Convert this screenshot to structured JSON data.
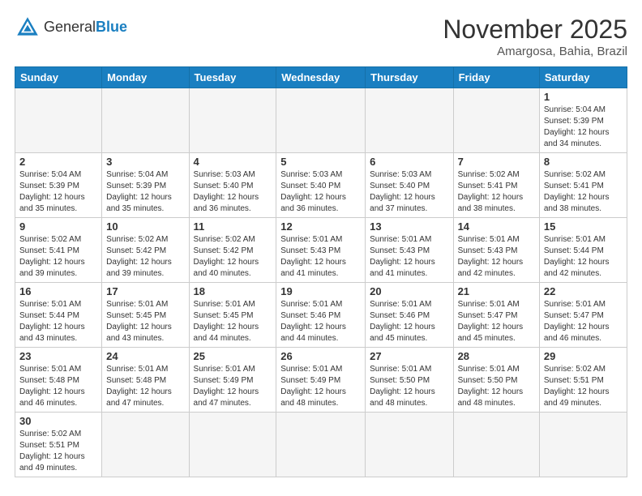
{
  "header": {
    "logo_general": "General",
    "logo_blue": "Blue",
    "month_year": "November 2025",
    "location": "Amargosa, Bahia, Brazil"
  },
  "days_of_week": [
    "Sunday",
    "Monday",
    "Tuesday",
    "Wednesday",
    "Thursday",
    "Friday",
    "Saturday"
  ],
  "weeks": [
    [
      {
        "day": "",
        "info": ""
      },
      {
        "day": "",
        "info": ""
      },
      {
        "day": "",
        "info": ""
      },
      {
        "day": "",
        "info": ""
      },
      {
        "day": "",
        "info": ""
      },
      {
        "day": "",
        "info": ""
      },
      {
        "day": "1",
        "info": "Sunrise: 5:04 AM\nSunset: 5:39 PM\nDaylight: 12 hours and 34 minutes."
      }
    ],
    [
      {
        "day": "2",
        "info": "Sunrise: 5:04 AM\nSunset: 5:39 PM\nDaylight: 12 hours and 35 minutes."
      },
      {
        "day": "3",
        "info": "Sunrise: 5:04 AM\nSunset: 5:39 PM\nDaylight: 12 hours and 35 minutes."
      },
      {
        "day": "4",
        "info": "Sunrise: 5:03 AM\nSunset: 5:40 PM\nDaylight: 12 hours and 36 minutes."
      },
      {
        "day": "5",
        "info": "Sunrise: 5:03 AM\nSunset: 5:40 PM\nDaylight: 12 hours and 36 minutes."
      },
      {
        "day": "6",
        "info": "Sunrise: 5:03 AM\nSunset: 5:40 PM\nDaylight: 12 hours and 37 minutes."
      },
      {
        "day": "7",
        "info": "Sunrise: 5:02 AM\nSunset: 5:41 PM\nDaylight: 12 hours and 38 minutes."
      },
      {
        "day": "8",
        "info": "Sunrise: 5:02 AM\nSunset: 5:41 PM\nDaylight: 12 hours and 38 minutes."
      }
    ],
    [
      {
        "day": "9",
        "info": "Sunrise: 5:02 AM\nSunset: 5:41 PM\nDaylight: 12 hours and 39 minutes."
      },
      {
        "day": "10",
        "info": "Sunrise: 5:02 AM\nSunset: 5:42 PM\nDaylight: 12 hours and 39 minutes."
      },
      {
        "day": "11",
        "info": "Sunrise: 5:02 AM\nSunset: 5:42 PM\nDaylight: 12 hours and 40 minutes."
      },
      {
        "day": "12",
        "info": "Sunrise: 5:01 AM\nSunset: 5:43 PM\nDaylight: 12 hours and 41 minutes."
      },
      {
        "day": "13",
        "info": "Sunrise: 5:01 AM\nSunset: 5:43 PM\nDaylight: 12 hours and 41 minutes."
      },
      {
        "day": "14",
        "info": "Sunrise: 5:01 AM\nSunset: 5:43 PM\nDaylight: 12 hours and 42 minutes."
      },
      {
        "day": "15",
        "info": "Sunrise: 5:01 AM\nSunset: 5:44 PM\nDaylight: 12 hours and 42 minutes."
      }
    ],
    [
      {
        "day": "16",
        "info": "Sunrise: 5:01 AM\nSunset: 5:44 PM\nDaylight: 12 hours and 43 minutes."
      },
      {
        "day": "17",
        "info": "Sunrise: 5:01 AM\nSunset: 5:45 PM\nDaylight: 12 hours and 43 minutes."
      },
      {
        "day": "18",
        "info": "Sunrise: 5:01 AM\nSunset: 5:45 PM\nDaylight: 12 hours and 44 minutes."
      },
      {
        "day": "19",
        "info": "Sunrise: 5:01 AM\nSunset: 5:46 PM\nDaylight: 12 hours and 44 minutes."
      },
      {
        "day": "20",
        "info": "Sunrise: 5:01 AM\nSunset: 5:46 PM\nDaylight: 12 hours and 45 minutes."
      },
      {
        "day": "21",
        "info": "Sunrise: 5:01 AM\nSunset: 5:47 PM\nDaylight: 12 hours and 45 minutes."
      },
      {
        "day": "22",
        "info": "Sunrise: 5:01 AM\nSunset: 5:47 PM\nDaylight: 12 hours and 46 minutes."
      }
    ],
    [
      {
        "day": "23",
        "info": "Sunrise: 5:01 AM\nSunset: 5:48 PM\nDaylight: 12 hours and 46 minutes."
      },
      {
        "day": "24",
        "info": "Sunrise: 5:01 AM\nSunset: 5:48 PM\nDaylight: 12 hours and 47 minutes."
      },
      {
        "day": "25",
        "info": "Sunrise: 5:01 AM\nSunset: 5:49 PM\nDaylight: 12 hours and 47 minutes."
      },
      {
        "day": "26",
        "info": "Sunrise: 5:01 AM\nSunset: 5:49 PM\nDaylight: 12 hours and 48 minutes."
      },
      {
        "day": "27",
        "info": "Sunrise: 5:01 AM\nSunset: 5:50 PM\nDaylight: 12 hours and 48 minutes."
      },
      {
        "day": "28",
        "info": "Sunrise: 5:01 AM\nSunset: 5:50 PM\nDaylight: 12 hours and 48 minutes."
      },
      {
        "day": "29",
        "info": "Sunrise: 5:02 AM\nSunset: 5:51 PM\nDaylight: 12 hours and 49 minutes."
      }
    ],
    [
      {
        "day": "30",
        "info": "Sunrise: 5:02 AM\nSunset: 5:51 PM\nDaylight: 12 hours and 49 minutes."
      },
      {
        "day": "",
        "info": ""
      },
      {
        "day": "",
        "info": ""
      },
      {
        "day": "",
        "info": ""
      },
      {
        "day": "",
        "info": ""
      },
      {
        "day": "",
        "info": ""
      },
      {
        "day": "",
        "info": ""
      }
    ]
  ]
}
